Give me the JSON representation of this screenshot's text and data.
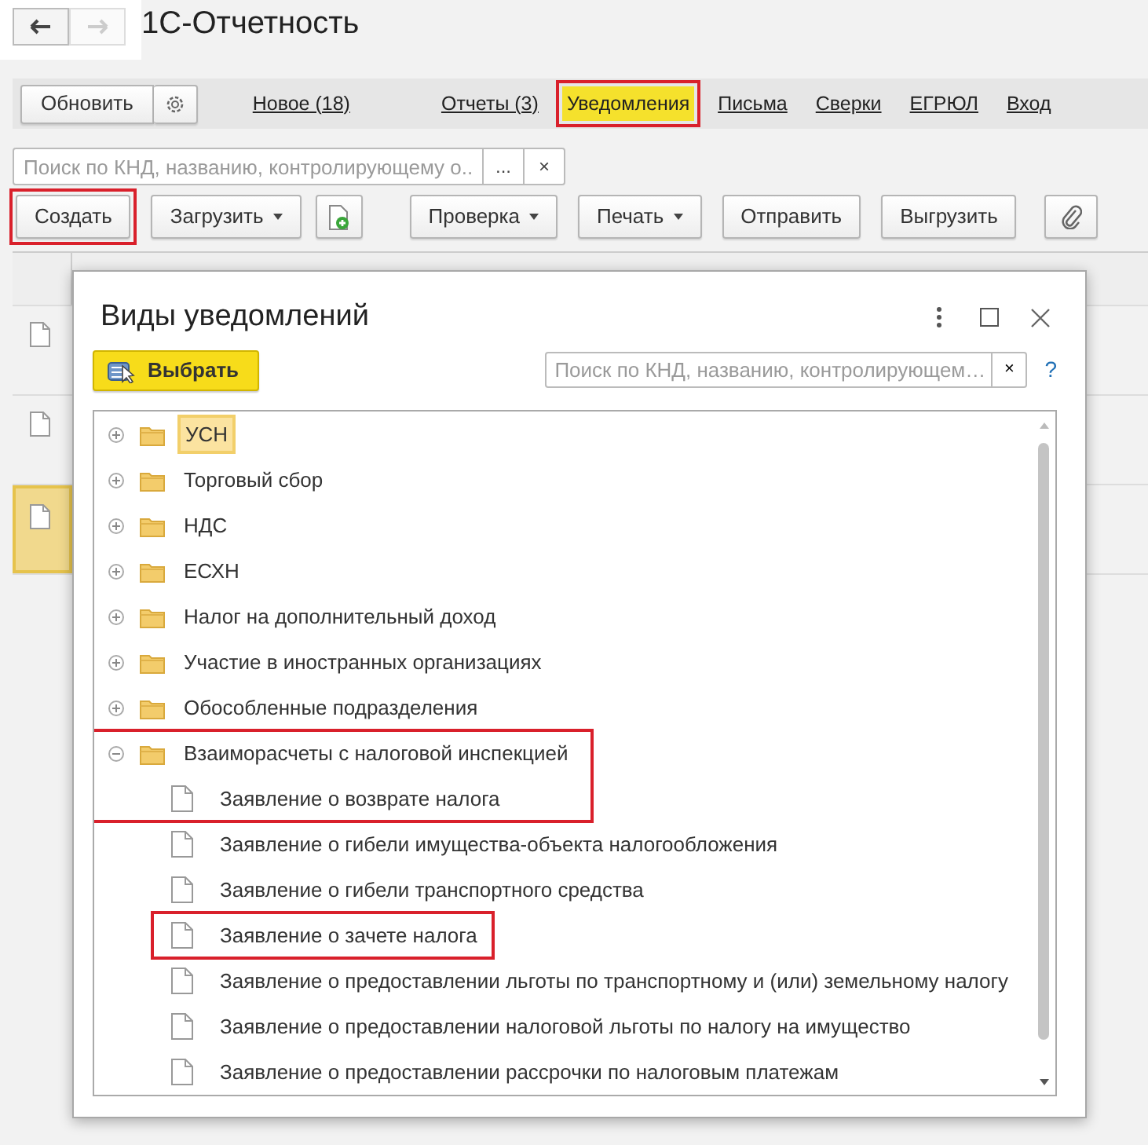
{
  "nav": {
    "back_enabled": true,
    "forward_enabled": false
  },
  "window": {
    "title": "1С-Отчетность"
  },
  "tab_bar": {
    "refresh_button": "Обновить",
    "tabs": [
      {
        "label": "Новое (18)",
        "selected": false,
        "highlighted": false
      },
      {
        "label": "Отчеты (3)",
        "selected": false,
        "highlighted": false
      },
      {
        "label": "Уведомления",
        "selected": true,
        "highlighted": true
      },
      {
        "label": "Письма",
        "selected": false,
        "highlighted": false
      },
      {
        "label": "Сверки",
        "selected": false,
        "highlighted": false
      },
      {
        "label": "ЕГРЮЛ",
        "selected": false,
        "highlighted": false
      },
      {
        "label": "Вход",
        "selected": false,
        "highlighted": false
      }
    ]
  },
  "search": {
    "placeholder": "Поиск по КНД, названию, контролирующему о...",
    "choose_button": "...",
    "clear_button": "×"
  },
  "toolbar": [
    {
      "kind": "text",
      "label": "Создать",
      "dropdown": false,
      "highlighted": true
    },
    {
      "kind": "text",
      "label": "Загрузить",
      "dropdown": true,
      "highlighted": false
    },
    {
      "kind": "add-icon"
    },
    {
      "kind": "text",
      "label": "Проверка",
      "dropdown": true,
      "highlighted": false
    },
    {
      "kind": "text",
      "label": "Печать",
      "dropdown": true,
      "highlighted": false
    },
    {
      "kind": "text",
      "label": "Отправить",
      "dropdown": false,
      "highlighted": false
    },
    {
      "kind": "text",
      "label": "Выгрузить",
      "dropdown": false,
      "highlighted": false
    },
    {
      "kind": "attach-icon"
    }
  ],
  "table": {
    "rows": [
      {
        "selected": false
      },
      {
        "selected": false
      },
      {
        "selected": true
      }
    ]
  },
  "dialog": {
    "title": "Виды уведомлений",
    "select_button": "Выбрать",
    "search_placeholder": "Поиск по КНД, названию, контролирующем…",
    "clear_button": "×",
    "help_link": "?",
    "tree": [
      {
        "kind": "folder",
        "label": "УСН",
        "expanded": false,
        "selected": true,
        "highlighted": false
      },
      {
        "kind": "folder",
        "label": "Торговый сбор",
        "expanded": false,
        "selected": false,
        "highlighted": false
      },
      {
        "kind": "folder",
        "label": "НДС",
        "expanded": false,
        "selected": false,
        "highlighted": false
      },
      {
        "kind": "folder",
        "label": "ЕСХН",
        "expanded": false,
        "selected": false,
        "highlighted": false
      },
      {
        "kind": "folder",
        "label": "Налог на дополнительный доход",
        "expanded": false,
        "selected": false,
        "highlighted": false
      },
      {
        "kind": "folder",
        "label": "Участие в иностранных организациях",
        "expanded": false,
        "selected": false,
        "highlighted": false
      },
      {
        "kind": "folder",
        "label": "Обособленные подразделения",
        "expanded": false,
        "selected": false,
        "highlighted": false
      },
      {
        "kind": "folder",
        "label": "Взаиморасчеты с налоговой инспекцией",
        "expanded": true,
        "selected": false,
        "highlighted": true,
        "children": [
          {
            "kind": "document",
            "label": "Заявление о возврате налога",
            "selected": false,
            "highlighted": true
          },
          {
            "kind": "document",
            "label": "Заявление о гибели имущества-объекта налогообложения",
            "selected": false,
            "highlighted": false
          },
          {
            "kind": "document",
            "label": "Заявление о гибели транспортного средства",
            "selected": false,
            "highlighted": false
          },
          {
            "kind": "document",
            "label": "Заявление о зачете налога",
            "selected": false,
            "highlighted": true
          },
          {
            "kind": "document",
            "label": "Заявление о предоставлении льготы по транспортному и (или) земельному налогу",
            "selected": false,
            "highlighted": false
          },
          {
            "kind": "document",
            "label": "Заявление о предоставлении налоговой льготы по налогу на имущество",
            "selected": false,
            "highlighted": false
          },
          {
            "kind": "document",
            "label": "Заявление о предоставлении рассрочки по налоговым платежам",
            "selected": false,
            "highlighted": false
          }
        ]
      }
    ]
  }
}
